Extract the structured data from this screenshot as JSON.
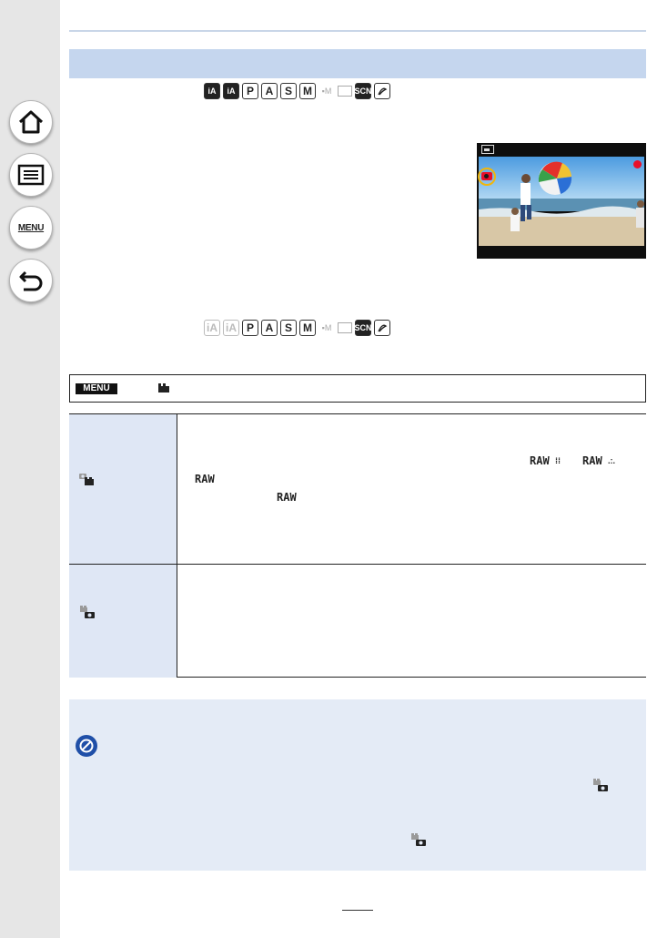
{
  "sidebar": {
    "menu_label": "MENU",
    "icons": [
      "home-icon",
      "contents-list-icon",
      "menu-icon",
      "back-arrow-icon"
    ]
  },
  "mode_row_1": {
    "modes": [
      {
        "label": "iA",
        "style": "dark"
      },
      {
        "label": "iA+",
        "style": "dark"
      },
      {
        "label": "P",
        "style": "box"
      },
      {
        "label": "A",
        "style": "box"
      },
      {
        "label": "S",
        "style": "box"
      },
      {
        "label": "M",
        "style": "box"
      },
      {
        "label": "M",
        "style": "faint-movie"
      },
      {
        "label": "",
        "style": "faint-frame"
      },
      {
        "label": "SCN",
        "style": "dark"
      },
      {
        "label": "",
        "style": "creative"
      }
    ]
  },
  "mode_row_2": {
    "modes": [
      {
        "label": "iA",
        "style": "faint"
      },
      {
        "label": "iA+",
        "style": "faint"
      },
      {
        "label": "P",
        "style": "box"
      },
      {
        "label": "A",
        "style": "box"
      },
      {
        "label": "S",
        "style": "box"
      },
      {
        "label": "M",
        "style": "box"
      },
      {
        "label": "M",
        "style": "faint-movie"
      },
      {
        "label": "",
        "style": "faint-frame"
      },
      {
        "label": "SCN",
        "style": "dark"
      },
      {
        "label": "",
        "style": "creative"
      }
    ]
  },
  "menu_path": {
    "chip": "MENU",
    "icon": "motion-picture-menu-icon"
  },
  "table": {
    "row1_icon": "photo-priority-icon",
    "row2_icon": "video-priority-icon",
    "raw_labels": [
      "RAW",
      "RAW",
      "RAW",
      "RAW"
    ]
  },
  "note": {
    "icon": "not-available-icon"
  },
  "colors": {
    "header_bar": "#c5d6ee",
    "table_label_bg": "#dfe7f5",
    "note_bg": "#e4ebf6",
    "note_icon": "#1f4fa8",
    "rec_dot": "#e8102a",
    "highlight_ring": "#f1b60b"
  }
}
